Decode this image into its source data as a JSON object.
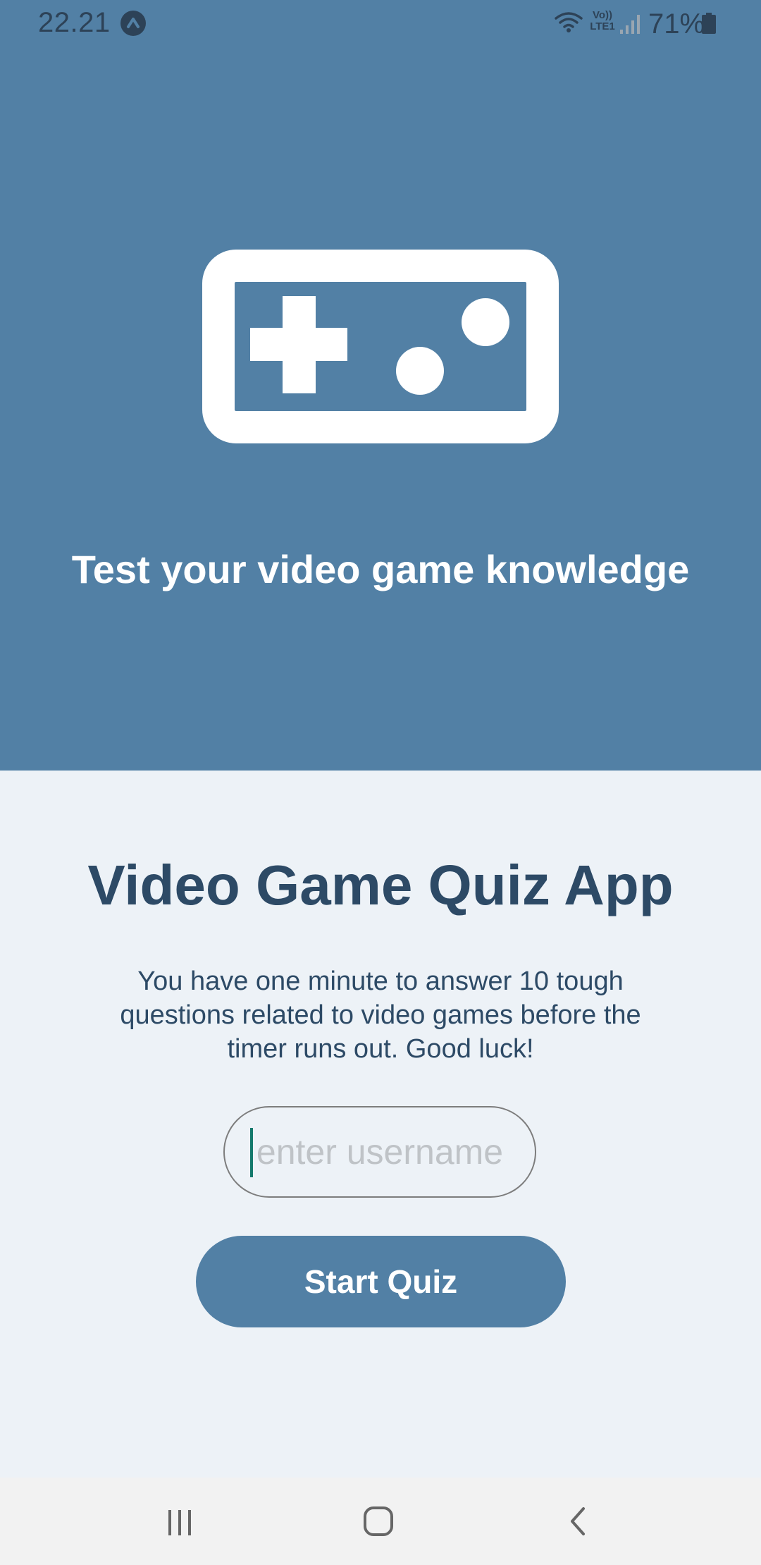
{
  "status_bar": {
    "time": "22.21",
    "volte": "Vo)) LTE1",
    "battery": "71%",
    "icons": [
      "app-notification-icon",
      "wifi-icon",
      "signal-icon",
      "battery-icon"
    ]
  },
  "hero": {
    "icon": "gamepad-icon",
    "tagline": "Test your video game knowledge"
  },
  "main": {
    "title": "Video Game Quiz App",
    "description": "You have one minute to answer 10 tough questions related to video games before the timer runs out. Good luck!",
    "username": {
      "value": "",
      "placeholder": "enter username"
    },
    "start_button_label": "Start Quiz"
  },
  "nav_bar": {
    "icons": [
      "recents-icon",
      "home-icon",
      "back-icon"
    ]
  },
  "colors": {
    "accent": "#5280a5",
    "background": "#edf2f7",
    "text_dark": "#2d4a66",
    "caret": "#14796c"
  }
}
